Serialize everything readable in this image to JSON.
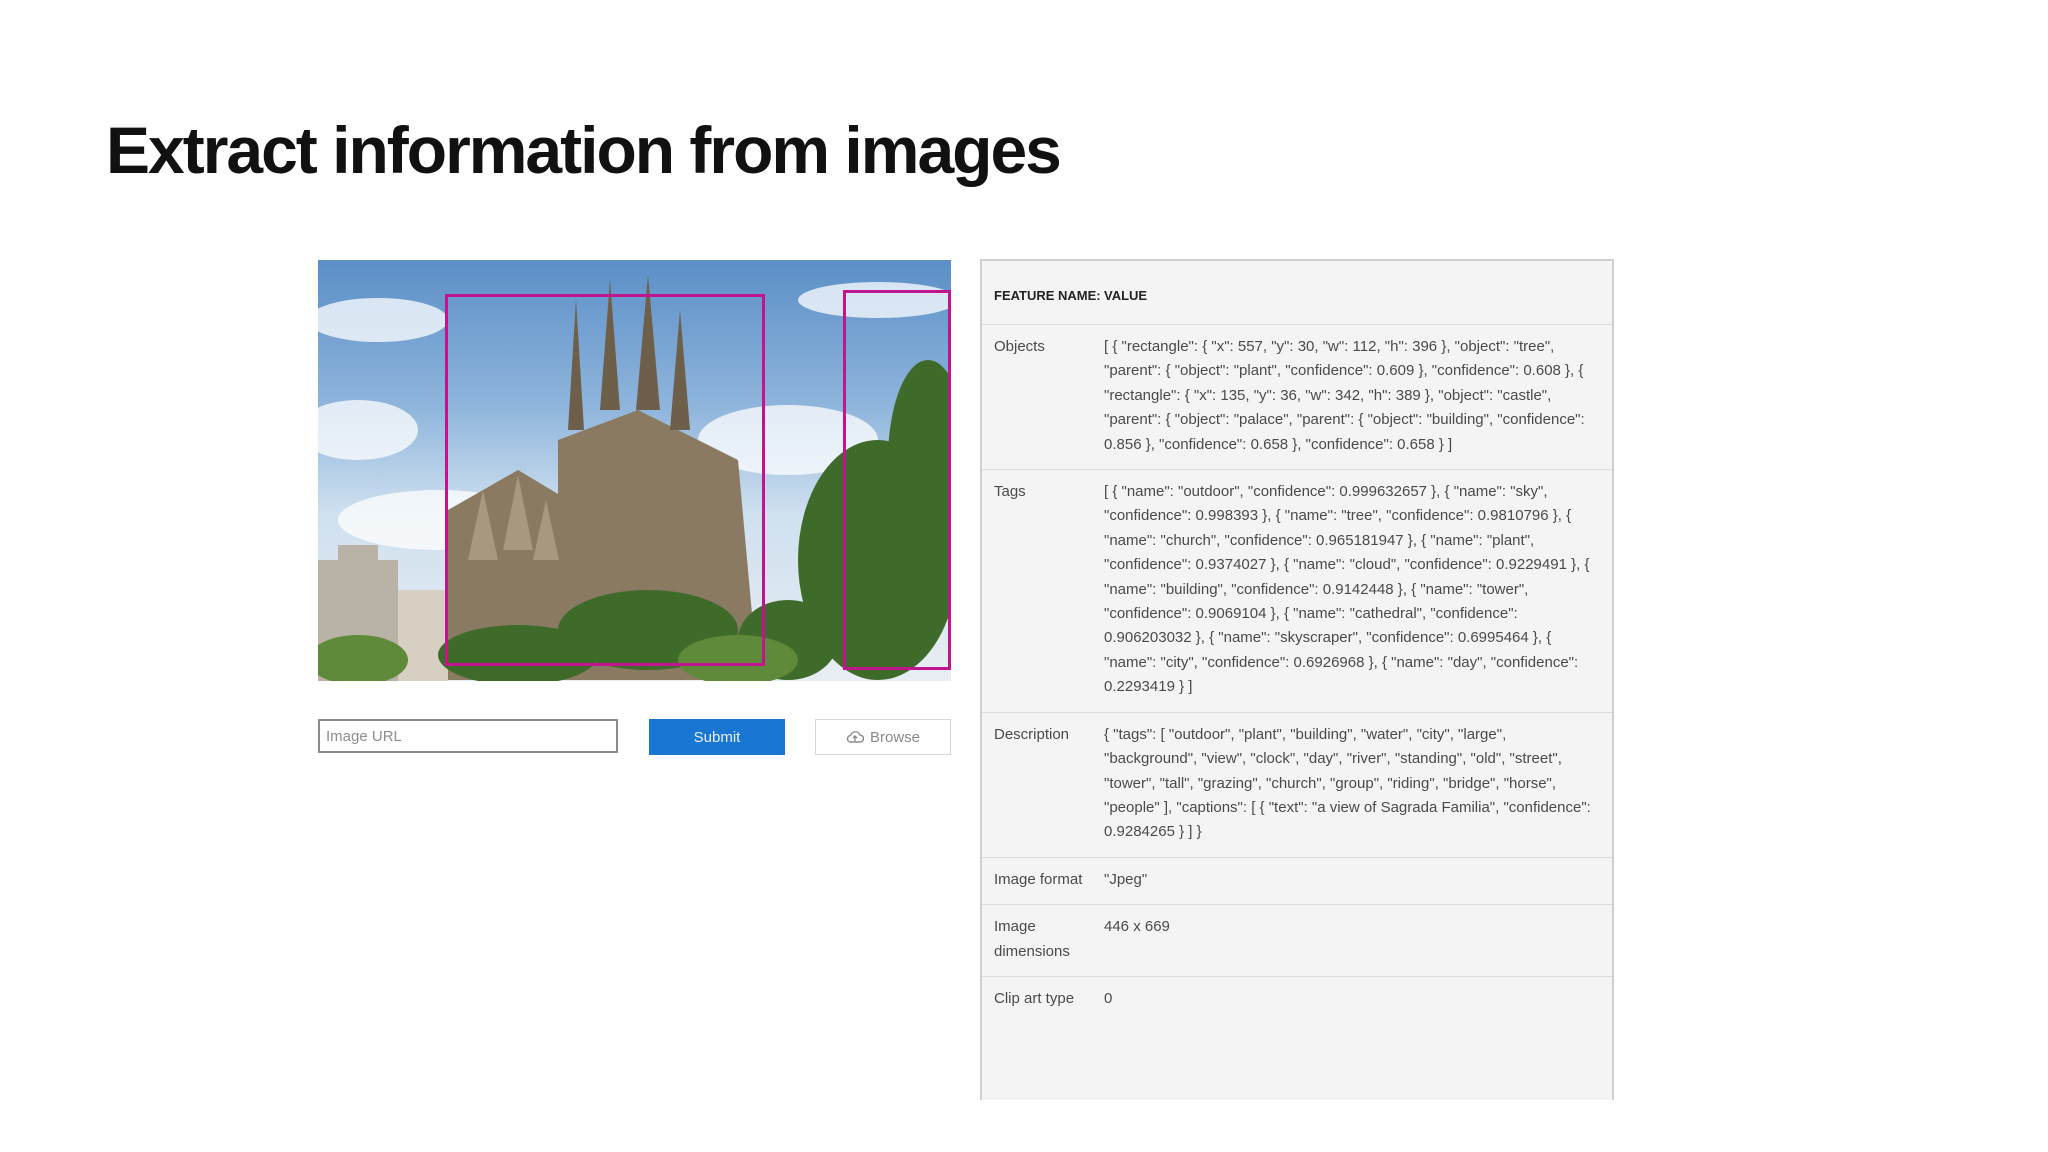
{
  "slide": {
    "title": "Extract information from images"
  },
  "analyzer": {
    "url_placeholder": "Image URL",
    "submit_label": "Submit",
    "browse_label": "Browse",
    "box_color": "#c0158f",
    "submit_color": "#1976d2"
  },
  "results": {
    "header": {
      "feature": "FEATURE NAME:",
      "value": "VALUE"
    },
    "rows": [
      {
        "feature": "Objects",
        "value": "[ { \"rectangle\": { \"x\": 557, \"y\": 30, \"w\": 112, \"h\": 396 }, \"object\": \"tree\", \"parent\": { \"object\": \"plant\", \"confidence\": 0.609 }, \"confidence\": 0.608 }, { \"rectangle\": { \"x\": 135, \"y\": 36, \"w\": 342, \"h\": 389 }, \"object\": \"castle\", \"parent\": { \"object\": \"palace\", \"parent\": { \"object\": \"building\", \"confidence\": 0.856 }, \"confidence\": 0.658 }, \"confidence\": 0.658 } ]"
      },
      {
        "feature": "Tags",
        "value": "[ { \"name\": \"outdoor\", \"confidence\": 0.999632657 }, { \"name\": \"sky\", \"confidence\": 0.998393 }, { \"name\": \"tree\", \"confidence\": 0.9810796 }, { \"name\": \"church\", \"confidence\": 0.965181947 }, { \"name\": \"plant\", \"confidence\": 0.9374027 }, { \"name\": \"cloud\", \"confidence\": 0.9229491 }, { \"name\": \"building\", \"confidence\": 0.9142448 }, { \"name\": \"tower\", \"confidence\": 0.9069104 }, { \"name\": \"cathedral\", \"confidence\": 0.906203032 }, { \"name\": \"skyscraper\", \"confidence\": 0.6995464 }, { \"name\": \"city\", \"confidence\": 0.6926968 }, { \"name\": \"day\", \"confidence\": 0.2293419 } ]"
      },
      {
        "feature": "Description",
        "value": "{ \"tags\": [ \"outdoor\", \"plant\", \"building\", \"water\", \"city\", \"large\", \"background\", \"view\", \"clock\", \"day\", \"river\", \"standing\", \"old\", \"street\", \"tower\", \"tall\", \"grazing\", \"church\", \"group\", \"riding\", \"bridge\", \"horse\", \"people\" ], \"captions\": [ { \"text\": \"a view of Sagrada Familia\", \"confidence\": 0.9284265 } ] }"
      },
      {
        "feature": "Image format",
        "value": "\"Jpeg\""
      },
      {
        "feature": "Image dimensions",
        "value": "446 x 669"
      },
      {
        "feature": "Clip art type",
        "value": "0"
      }
    ]
  }
}
